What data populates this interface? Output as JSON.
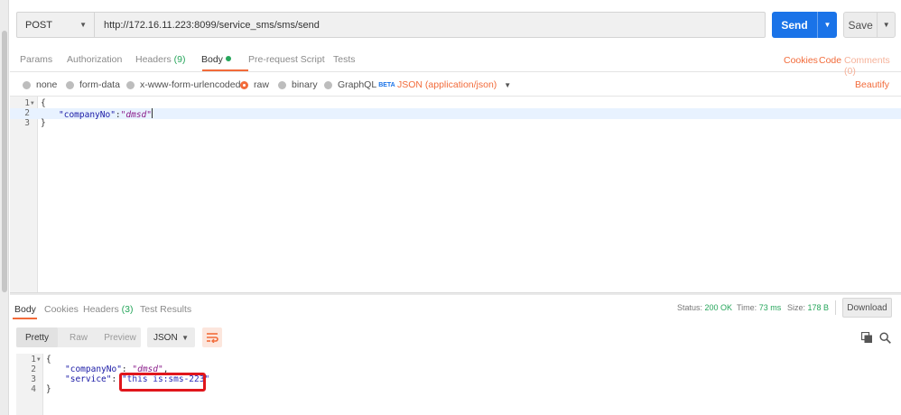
{
  "request": {
    "method": "POST",
    "url": "http://172.16.11.223:8099/service_sms/sms/send",
    "send_label": "Send",
    "save_label": "Save"
  },
  "request_tabs": {
    "params": "Params",
    "authorization": "Authorization",
    "headers": "Headers",
    "headers_count": "(9)",
    "body": "Body",
    "prerequest": "Pre-request Script",
    "tests": "Tests",
    "cookies": "Cookies",
    "code": "Code",
    "comments": "Comments (0)"
  },
  "body_types": {
    "none": "none",
    "form_data": "form-data",
    "urlencoded": "x-www-form-urlencoded",
    "raw": "raw",
    "binary": "binary",
    "graphql": "GraphQL",
    "beta": "BETA",
    "selected": "raw",
    "content_type": "JSON (application/json)",
    "beautify": "Beautify"
  },
  "request_body": {
    "lines": [
      {
        "num": "1",
        "text": "{"
      },
      {
        "num": "2",
        "key": "\"companyNo\"",
        "sep": ":",
        "value": "\"dmsd\""
      },
      {
        "num": "3",
        "text": "}"
      }
    ]
  },
  "response_tabs": {
    "body": "Body",
    "cookies": "Cookies",
    "headers": "Headers",
    "headers_count": "(3)",
    "test_results": "Test Results"
  },
  "response_status": {
    "status_label": "Status:",
    "status_value": "200 OK",
    "time_label": "Time:",
    "time_value": "73 ms",
    "size_label": "Size:",
    "size_value": "178 B",
    "download": "Download"
  },
  "response_toolbar": {
    "pretty": "Pretty",
    "raw": "Raw",
    "preview": "Preview",
    "format": "JSON"
  },
  "response_body": {
    "lines": [
      {
        "num": "1",
        "text": "{"
      },
      {
        "num": "2",
        "key": "\"companyNo\"",
        "sep": ": ",
        "value": "\"dmsd\"",
        "trail": ","
      },
      {
        "num": "3",
        "key": "\"service\"",
        "sep": ": ",
        "value": "\"this is:sms-223\""
      },
      {
        "num": "4",
        "text": "}"
      }
    ]
  },
  "colors": {
    "accent": "#f26b3a",
    "send_blue": "#1a73e8",
    "status_green": "#26a65b",
    "highlight_box": "#e0161c"
  },
  "icons": [
    "chevron-down-icon",
    "wrap-lines-icon",
    "copy-icon",
    "search-icon",
    "fold-arrow-icon"
  ]
}
